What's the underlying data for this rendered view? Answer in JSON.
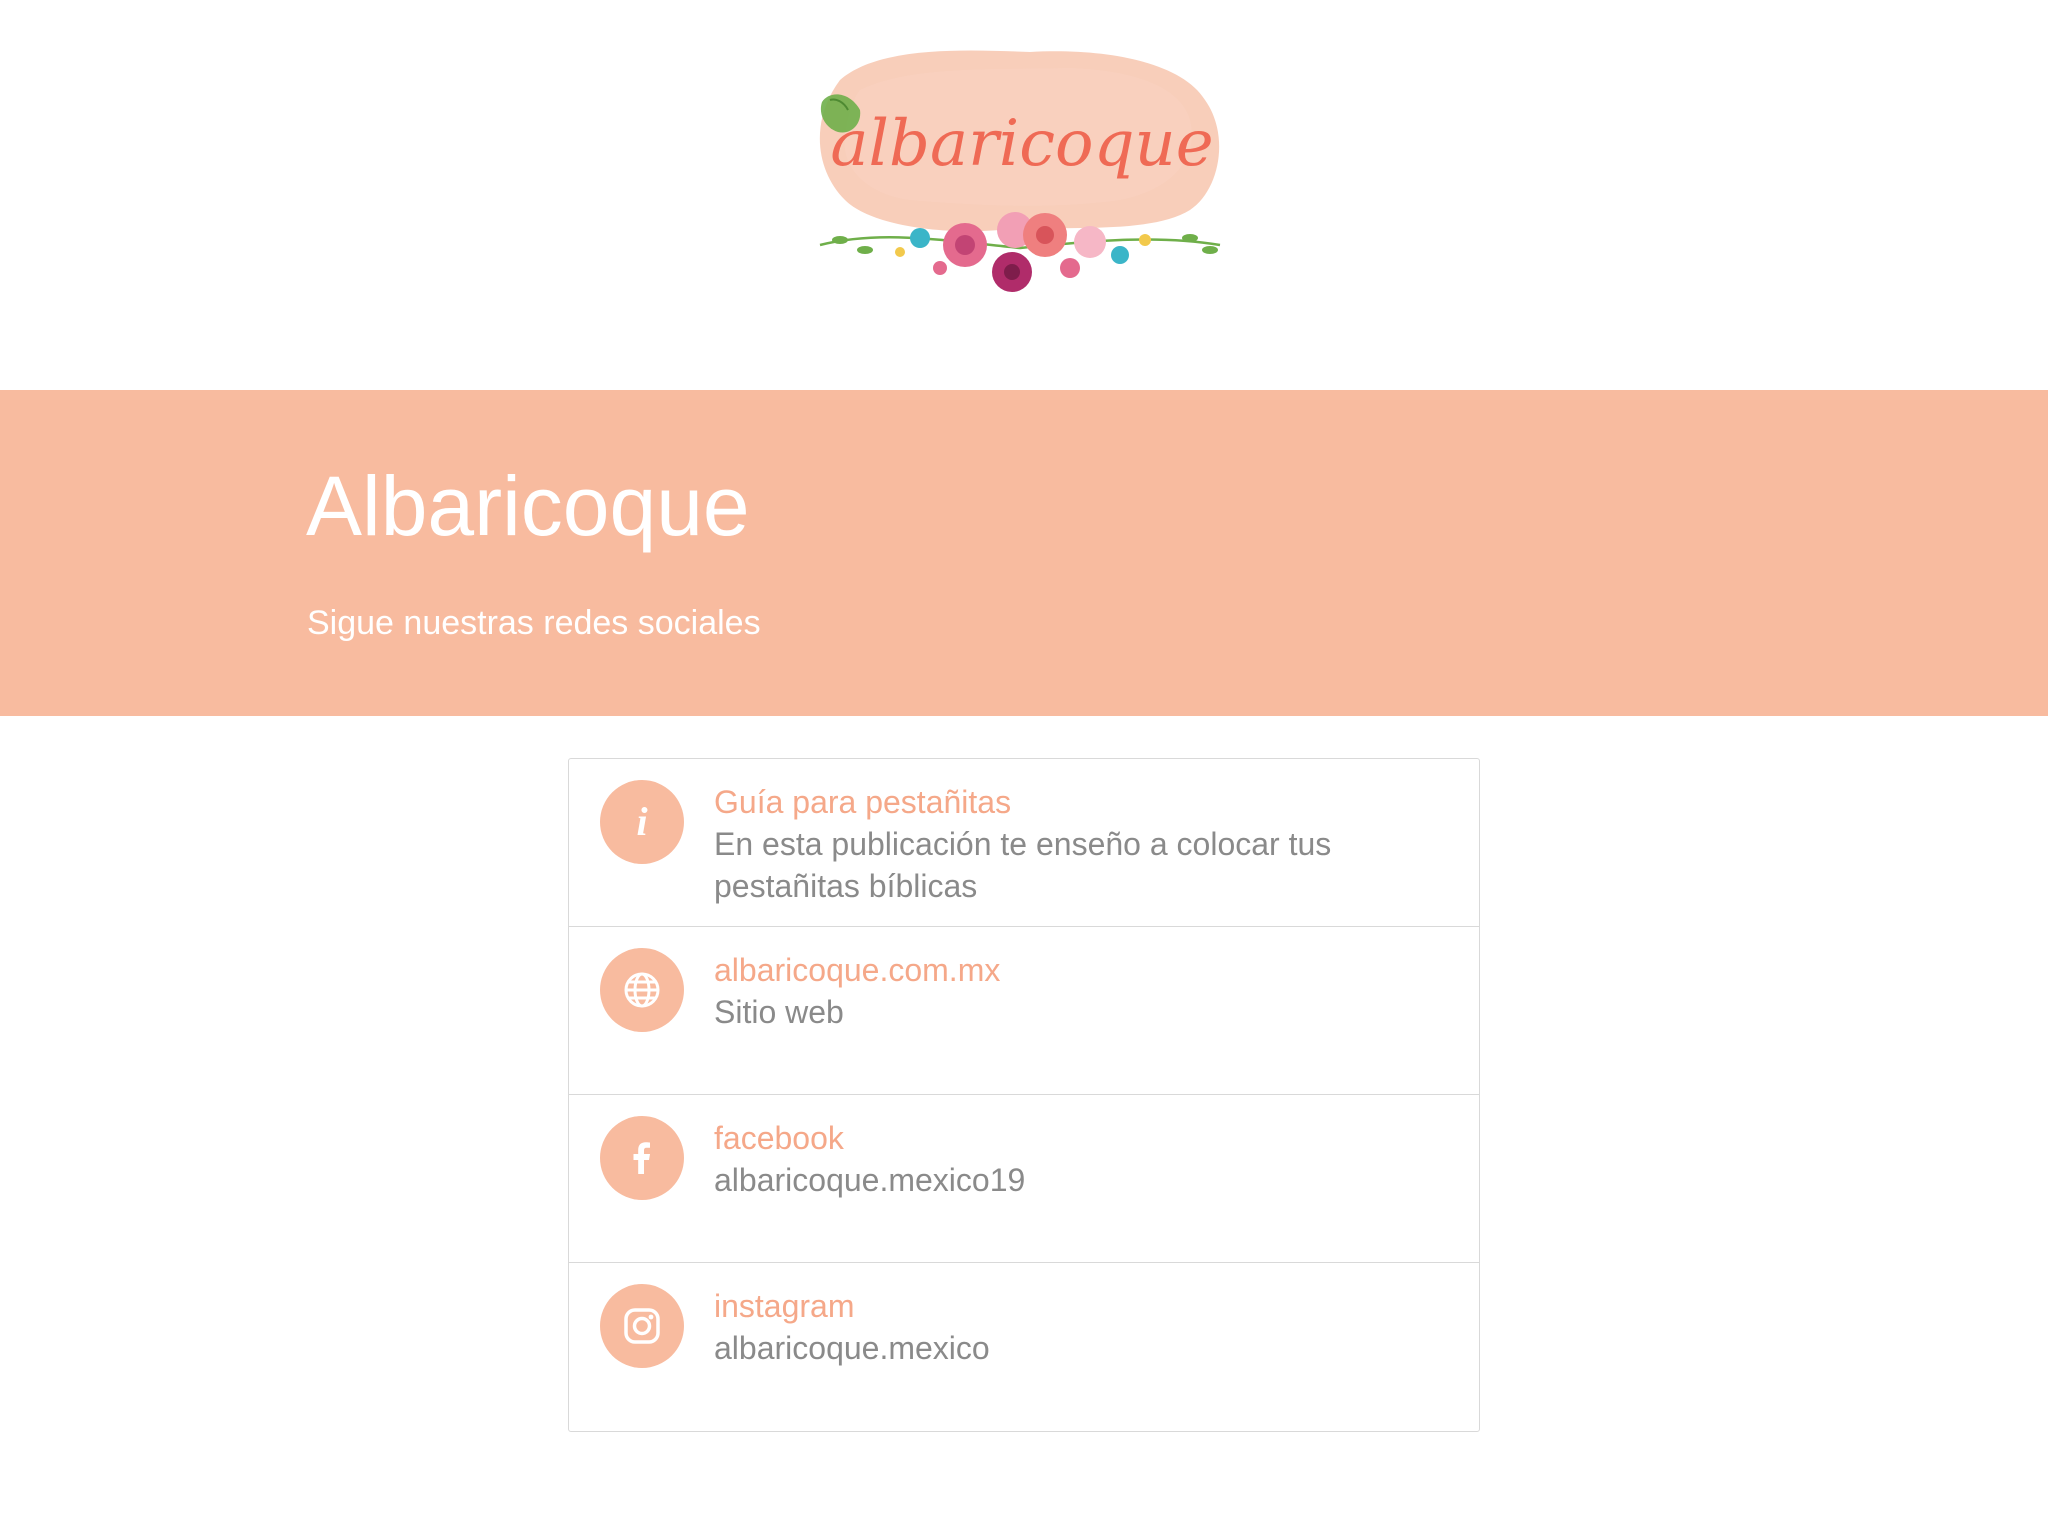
{
  "logo": {
    "text": "albaricoque",
    "colors": {
      "watercolor": "#F7C6AE",
      "lettering": "#EF6A55",
      "leaf": "#6FAF4A",
      "flower_pink": "#E46A8E",
      "flower_magenta": "#B02C6A",
      "flower_teal": "#3BB5C8"
    }
  },
  "hero": {
    "title": "Albaricoque",
    "subtitle": "Sigue nuestras redes sociales",
    "background": "#F8BB9F"
  },
  "links": [
    {
      "icon": "info-icon",
      "title": "Guía para pestañitas",
      "description": "En esta publicación te enseño a colocar tus pestañitas bíblicas"
    },
    {
      "icon": "globe-icon",
      "title": "albaricoque.com.mx",
      "description": "Sitio web"
    },
    {
      "icon": "facebook-icon",
      "title": "facebook",
      "description": "albaricoque.mexico19"
    },
    {
      "icon": "instagram-icon",
      "title": "instagram",
      "description": "albaricoque.mexico"
    }
  ],
  "colors": {
    "accent": "#F8BB9F",
    "title_text": "#F5A889",
    "description_text": "#8a8a8a",
    "border": "#d9d9d9"
  }
}
